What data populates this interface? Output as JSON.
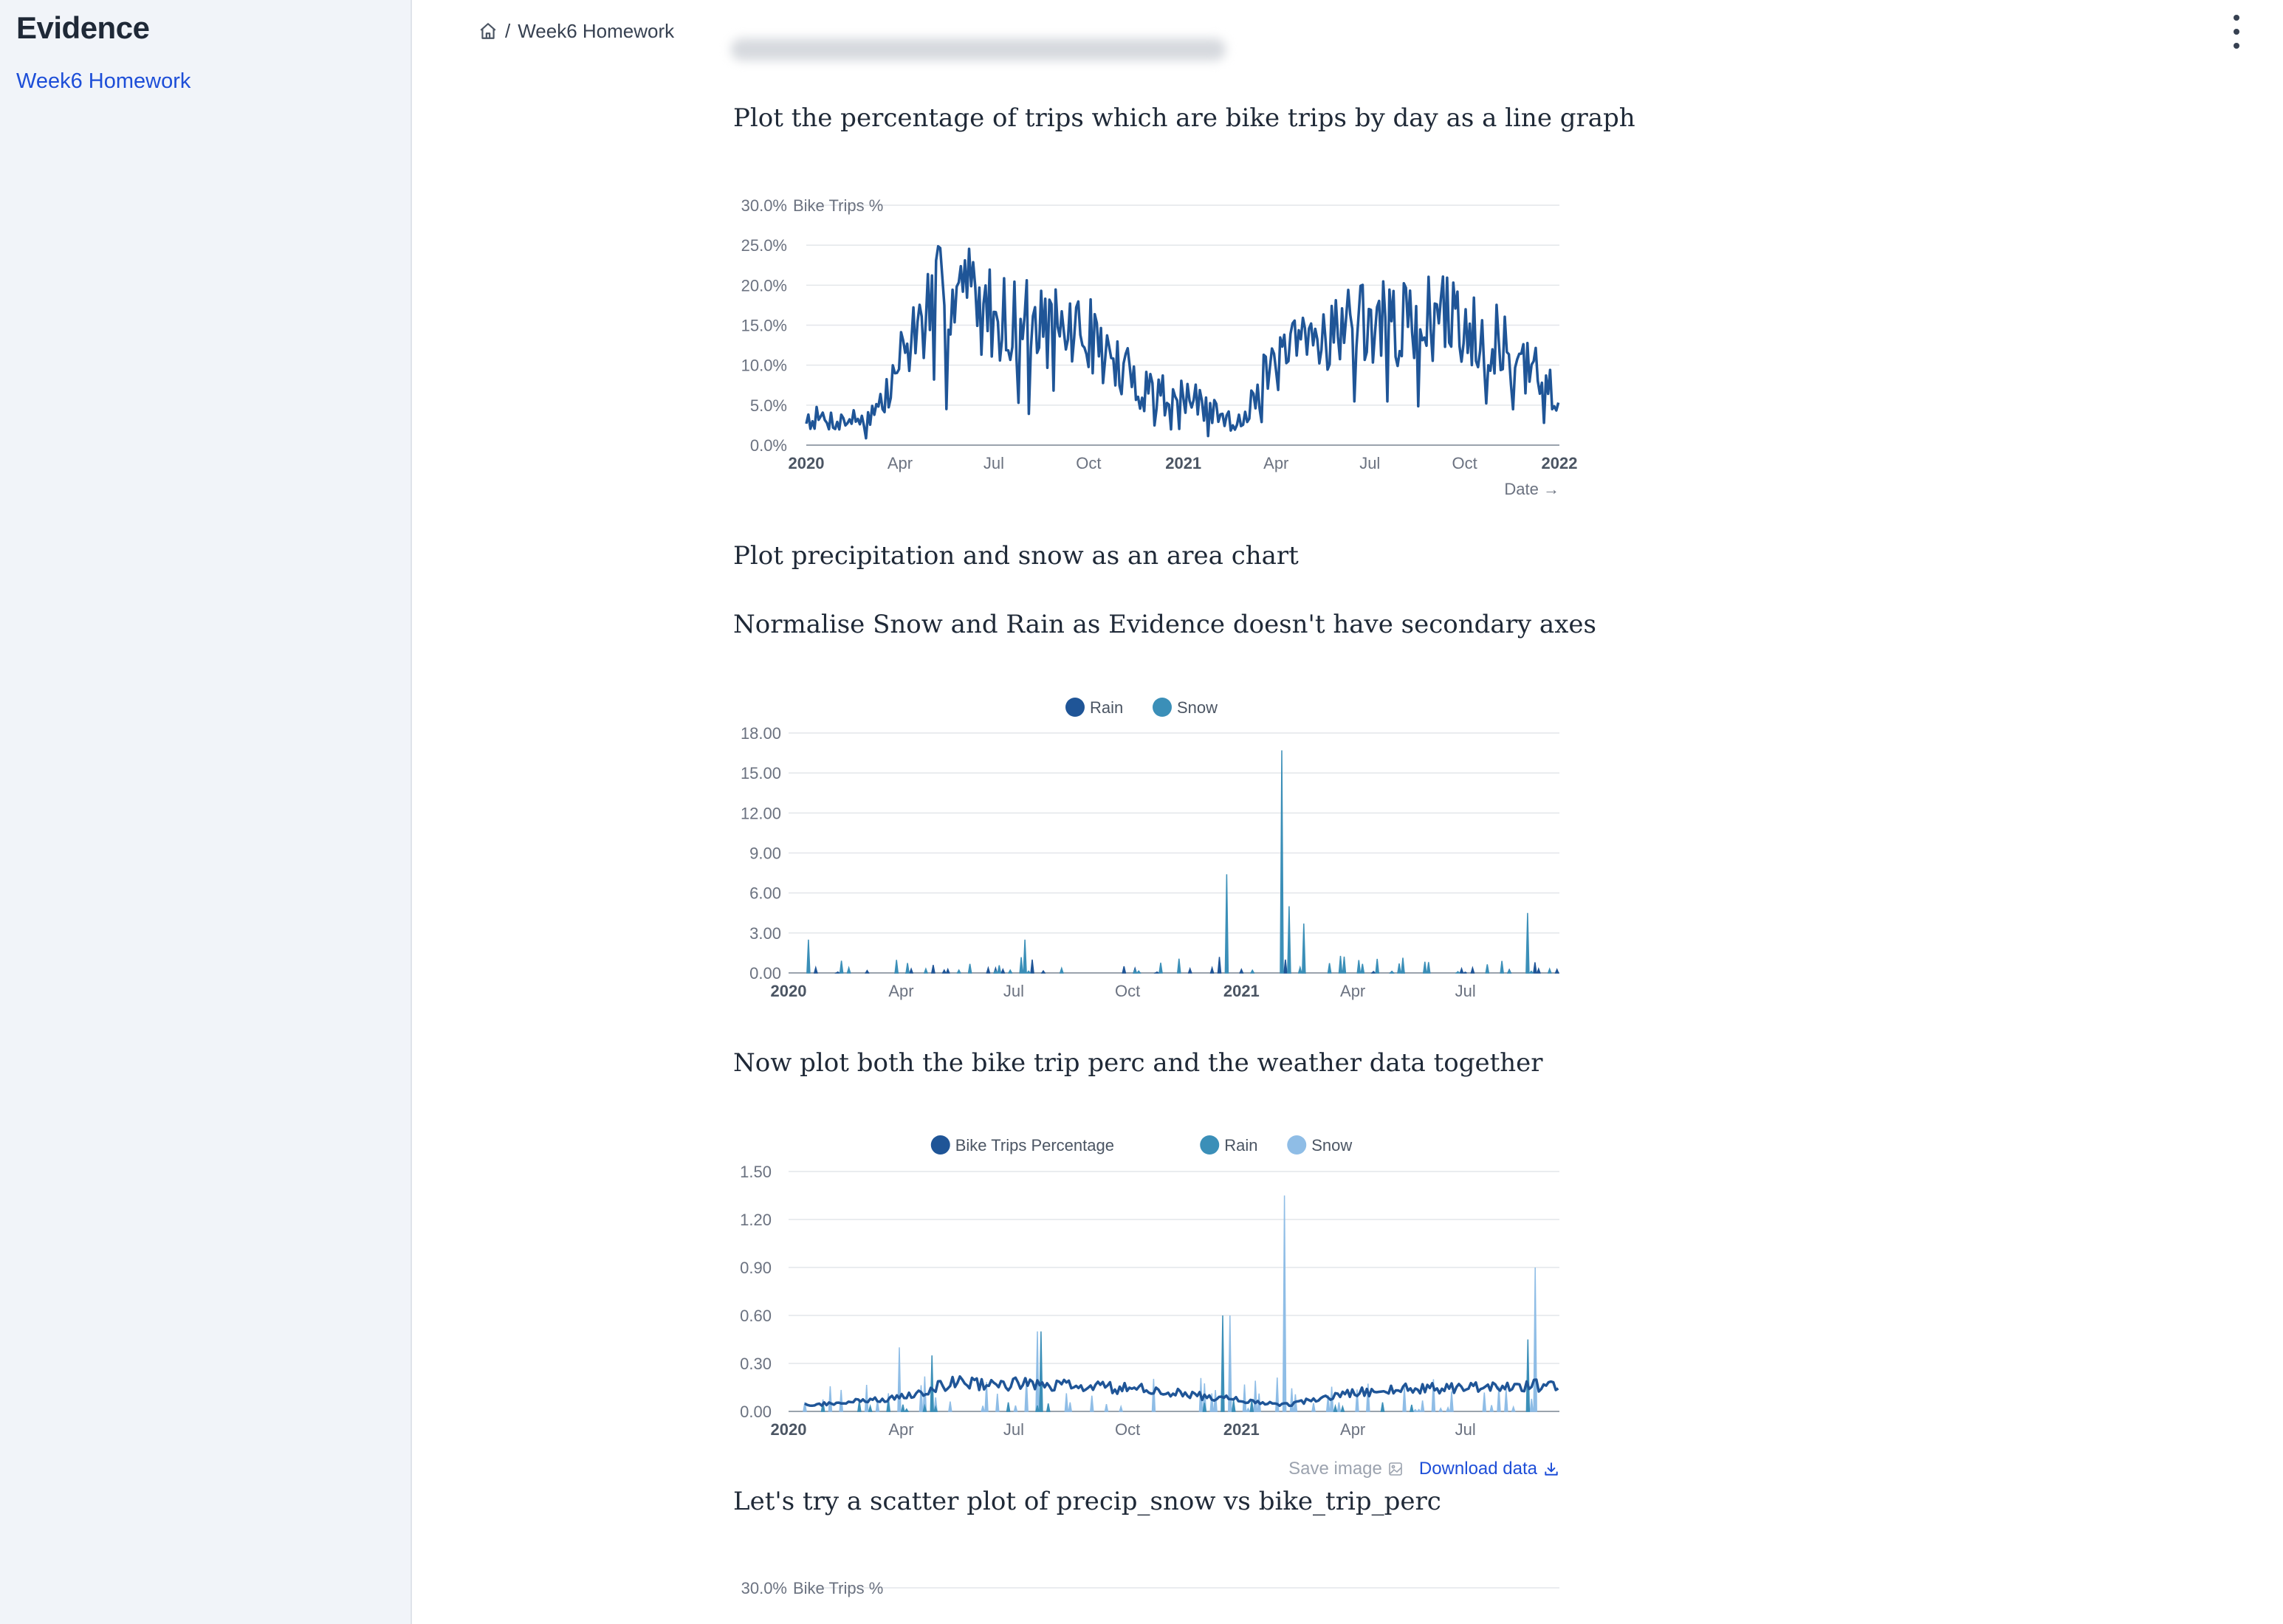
{
  "sidebar": {
    "logo": "Evidence",
    "links": [
      {
        "label": "Week6 Homework"
      }
    ]
  },
  "breadcrumb": {
    "separator": "/",
    "current": "Week6 Homework"
  },
  "headings": {
    "h1": "Plot the percentage of trips which are bike trips by day as a line graph",
    "h2": "Plot precipitation and snow as an area chart",
    "h3": "Normalise Snow and Rain as Evidence doesn't have secondary axes",
    "h4": "Now plot both the bike trip perc and the weather data together",
    "h5": "Let's try a scatter plot of precip_snow vs bike_trip_perc"
  },
  "toolbar": {
    "save_image": "Save image",
    "download_data": "Download data"
  },
  "colors": {
    "series1": "#1f5597",
    "series2": "#3b8fb8",
    "series3": "#8fbde6",
    "link": "#1d4ed8"
  },
  "chart_data": [
    {
      "type": "line",
      "title": "",
      "ylabel": "Bike Trips %",
      "xlabel": "Date →",
      "ylim": [
        0,
        30
      ],
      "yticks": [
        "0.0%",
        "5.0%",
        "10.0%",
        "15.0%",
        "20.0%",
        "25.0%",
        "30.0%"
      ],
      "xticks": [
        "2020",
        "Apr",
        "Jul",
        "Oct",
        "2021",
        "Apr",
        "Jul",
        "Oct",
        "2022"
      ],
      "grid": true,
      "series": [
        {
          "name": "Bike Trips %",
          "x": [
            "2020-01-01",
            "2020-02-01",
            "2020-03-01",
            "2020-03-20",
            "2020-04-01",
            "2020-04-20",
            "2020-05-10",
            "2020-06-01",
            "2020-06-20",
            "2020-07-10",
            "2020-08-01",
            "2020-09-01",
            "2020-10-01",
            "2020-11-01",
            "2020-12-01",
            "2021-01-01",
            "2021-02-01",
            "2021-02-20",
            "2021-03-10",
            "2021-04-01",
            "2021-05-01",
            "2021-06-01",
            "2021-07-01",
            "2021-08-01",
            "2021-09-01",
            "2021-10-01",
            "2021-11-01",
            "2021-12-01",
            "2021-12-31"
          ],
          "values": [
            3.5,
            3.0,
            3.5,
            6.0,
            11.0,
            15.0,
            19.0,
            20.0,
            17.0,
            16.0,
            15.5,
            14.5,
            14.0,
            9.0,
            7.0,
            6.0,
            4.0,
            2.5,
            6.0,
            10.0,
            13.0,
            15.0,
            15.5,
            15.0,
            16.0,
            15.5,
            13.0,
            9.0,
            7.0
          ]
        }
      ]
    },
    {
      "type": "area",
      "title": "",
      "legend": "top-center",
      "ylim": [
        0,
        18
      ],
      "yticks": [
        "0.00",
        "3.00",
        "6.00",
        "9.00",
        "12.00",
        "15.00",
        "18.00"
      ],
      "xticks": [
        "2020",
        "Apr",
        "Jul",
        "Oct",
        "2021",
        "Apr",
        "Jul"
      ],
      "grid": true,
      "series": [
        {
          "name": "Rain",
          "x": [
            "2020-01-15",
            "2020-04-20",
            "2020-07-10",
            "2020-12-10",
            "2021-02-02",
            "2021-08-25"
          ],
          "values": [
            0.4,
            0.6,
            1.0,
            1.2,
            1.0,
            0.8
          ]
        },
        {
          "name": "Snow",
          "x": [
            "2020-01-10",
            "2020-07-05",
            "2020-12-16",
            "2021-02-01",
            "2021-02-07",
            "2021-02-18",
            "2021-08-20"
          ],
          "values": [
            2.5,
            2.5,
            7.4,
            16.7,
            5.0,
            3.7,
            4.5
          ]
        }
      ]
    },
    {
      "type": "area",
      "title": "",
      "legend": "top-center",
      "ylim": [
        0,
        1.5
      ],
      "yticks": [
        "0.00",
        "0.30",
        "0.60",
        "0.90",
        "1.20",
        "1.50"
      ],
      "xticks": [
        "2020",
        "Apr",
        "Jul",
        "Oct",
        "2021",
        "Apr",
        "Jul"
      ],
      "grid": true,
      "series": [
        {
          "name": "Bike Trips Percentage",
          "x": [
            "2020-01-01",
            "2020-03-15",
            "2020-05-01",
            "2020-07-01",
            "2020-10-01",
            "2020-12-01",
            "2021-02-01",
            "2021-04-01",
            "2021-06-01",
            "2021-08-15"
          ],
          "values": [
            0.04,
            0.08,
            0.18,
            0.17,
            0.14,
            0.09,
            0.04,
            0.12,
            0.15,
            0.16
          ]
        },
        {
          "name": "Rain",
          "x": [
            "2020-04-15",
            "2020-07-15",
            "2020-12-10",
            "2021-08-20"
          ],
          "values": [
            0.35,
            0.5,
            0.6,
            0.45
          ]
        },
        {
          "name": "Snow",
          "x": [
            "2020-03-20",
            "2020-07-10",
            "2020-12-16",
            "2021-02-01",
            "2021-08-26"
          ],
          "values": [
            0.4,
            0.5,
            0.6,
            1.35,
            0.9
          ]
        }
      ]
    },
    {
      "type": "scatter",
      "title": "",
      "ylabel": "Bike Trips %",
      "yticks": [
        "30.0%"
      ],
      "series": []
    }
  ]
}
